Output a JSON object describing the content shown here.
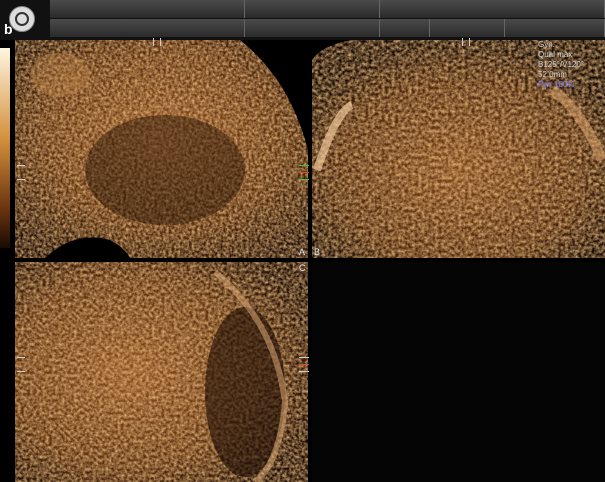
{
  "figure_label": "b",
  "colors": {
    "background": "#000000",
    "tissue_light": "#e8a868",
    "tissue_dark": "#2a1406",
    "label_blue": "#7d80ff"
  },
  "panels": {
    "a": {
      "label": "A"
    },
    "b": {
      "label": "B"
    },
    "c": {
      "label": "C"
    }
  },
  "info": {
    "line1": "Gyn.",
    "line2": "Qual max",
    "line3": "B125°/V120°",
    "line4": "52.0mm",
    "line5": "Pwr 100%"
  },
  "icons": {
    "logo": "ge-logo-icon"
  }
}
